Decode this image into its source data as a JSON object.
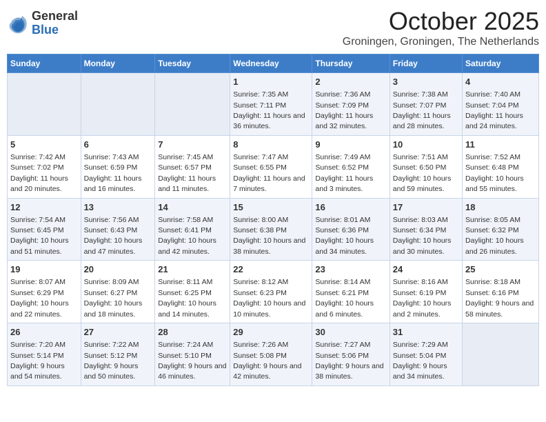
{
  "logo": {
    "general": "General",
    "blue": "Blue"
  },
  "title": "October 2025",
  "location": "Groningen, Groningen, The Netherlands",
  "days_of_week": [
    "Sunday",
    "Monday",
    "Tuesday",
    "Wednesday",
    "Thursday",
    "Friday",
    "Saturday"
  ],
  "weeks": [
    [
      {
        "day": "",
        "sunrise": "",
        "sunset": "",
        "daylight": "",
        "empty": true
      },
      {
        "day": "",
        "sunrise": "",
        "sunset": "",
        "daylight": "",
        "empty": true
      },
      {
        "day": "",
        "sunrise": "",
        "sunset": "",
        "daylight": "",
        "empty": true
      },
      {
        "day": "1",
        "sunrise": "Sunrise: 7:35 AM",
        "sunset": "Sunset: 7:11 PM",
        "daylight": "Daylight: 11 hours and 36 minutes."
      },
      {
        "day": "2",
        "sunrise": "Sunrise: 7:36 AM",
        "sunset": "Sunset: 7:09 PM",
        "daylight": "Daylight: 11 hours and 32 minutes."
      },
      {
        "day": "3",
        "sunrise": "Sunrise: 7:38 AM",
        "sunset": "Sunset: 7:07 PM",
        "daylight": "Daylight: 11 hours and 28 minutes."
      },
      {
        "day": "4",
        "sunrise": "Sunrise: 7:40 AM",
        "sunset": "Sunset: 7:04 PM",
        "daylight": "Daylight: 11 hours and 24 minutes."
      }
    ],
    [
      {
        "day": "5",
        "sunrise": "Sunrise: 7:42 AM",
        "sunset": "Sunset: 7:02 PM",
        "daylight": "Daylight: 11 hours and 20 minutes."
      },
      {
        "day": "6",
        "sunrise": "Sunrise: 7:43 AM",
        "sunset": "Sunset: 6:59 PM",
        "daylight": "Daylight: 11 hours and 16 minutes."
      },
      {
        "day": "7",
        "sunrise": "Sunrise: 7:45 AM",
        "sunset": "Sunset: 6:57 PM",
        "daylight": "Daylight: 11 hours and 11 minutes."
      },
      {
        "day": "8",
        "sunrise": "Sunrise: 7:47 AM",
        "sunset": "Sunset: 6:55 PM",
        "daylight": "Daylight: 11 hours and 7 minutes."
      },
      {
        "day": "9",
        "sunrise": "Sunrise: 7:49 AM",
        "sunset": "Sunset: 6:52 PM",
        "daylight": "Daylight: 11 hours and 3 minutes."
      },
      {
        "day": "10",
        "sunrise": "Sunrise: 7:51 AM",
        "sunset": "Sunset: 6:50 PM",
        "daylight": "Daylight: 10 hours and 59 minutes."
      },
      {
        "day": "11",
        "sunrise": "Sunrise: 7:52 AM",
        "sunset": "Sunset: 6:48 PM",
        "daylight": "Daylight: 10 hours and 55 minutes."
      }
    ],
    [
      {
        "day": "12",
        "sunrise": "Sunrise: 7:54 AM",
        "sunset": "Sunset: 6:45 PM",
        "daylight": "Daylight: 10 hours and 51 minutes."
      },
      {
        "day": "13",
        "sunrise": "Sunrise: 7:56 AM",
        "sunset": "Sunset: 6:43 PM",
        "daylight": "Daylight: 10 hours and 47 minutes."
      },
      {
        "day": "14",
        "sunrise": "Sunrise: 7:58 AM",
        "sunset": "Sunset: 6:41 PM",
        "daylight": "Daylight: 10 hours and 42 minutes."
      },
      {
        "day": "15",
        "sunrise": "Sunrise: 8:00 AM",
        "sunset": "Sunset: 6:38 PM",
        "daylight": "Daylight: 10 hours and 38 minutes."
      },
      {
        "day": "16",
        "sunrise": "Sunrise: 8:01 AM",
        "sunset": "Sunset: 6:36 PM",
        "daylight": "Daylight: 10 hours and 34 minutes."
      },
      {
        "day": "17",
        "sunrise": "Sunrise: 8:03 AM",
        "sunset": "Sunset: 6:34 PM",
        "daylight": "Daylight: 10 hours and 30 minutes."
      },
      {
        "day": "18",
        "sunrise": "Sunrise: 8:05 AM",
        "sunset": "Sunset: 6:32 PM",
        "daylight": "Daylight: 10 hours and 26 minutes."
      }
    ],
    [
      {
        "day": "19",
        "sunrise": "Sunrise: 8:07 AM",
        "sunset": "Sunset: 6:29 PM",
        "daylight": "Daylight: 10 hours and 22 minutes."
      },
      {
        "day": "20",
        "sunrise": "Sunrise: 8:09 AM",
        "sunset": "Sunset: 6:27 PM",
        "daylight": "Daylight: 10 hours and 18 minutes."
      },
      {
        "day": "21",
        "sunrise": "Sunrise: 8:11 AM",
        "sunset": "Sunset: 6:25 PM",
        "daylight": "Daylight: 10 hours and 14 minutes."
      },
      {
        "day": "22",
        "sunrise": "Sunrise: 8:12 AM",
        "sunset": "Sunset: 6:23 PM",
        "daylight": "Daylight: 10 hours and 10 minutes."
      },
      {
        "day": "23",
        "sunrise": "Sunrise: 8:14 AM",
        "sunset": "Sunset: 6:21 PM",
        "daylight": "Daylight: 10 hours and 6 minutes."
      },
      {
        "day": "24",
        "sunrise": "Sunrise: 8:16 AM",
        "sunset": "Sunset: 6:19 PM",
        "daylight": "Daylight: 10 hours and 2 minutes."
      },
      {
        "day": "25",
        "sunrise": "Sunrise: 8:18 AM",
        "sunset": "Sunset: 6:16 PM",
        "daylight": "Daylight: 9 hours and 58 minutes."
      }
    ],
    [
      {
        "day": "26",
        "sunrise": "Sunrise: 7:20 AM",
        "sunset": "Sunset: 5:14 PM",
        "daylight": "Daylight: 9 hours and 54 minutes."
      },
      {
        "day": "27",
        "sunrise": "Sunrise: 7:22 AM",
        "sunset": "Sunset: 5:12 PM",
        "daylight": "Daylight: 9 hours and 50 minutes."
      },
      {
        "day": "28",
        "sunrise": "Sunrise: 7:24 AM",
        "sunset": "Sunset: 5:10 PM",
        "daylight": "Daylight: 9 hours and 46 minutes."
      },
      {
        "day": "29",
        "sunrise": "Sunrise: 7:26 AM",
        "sunset": "Sunset: 5:08 PM",
        "daylight": "Daylight: 9 hours and 42 minutes."
      },
      {
        "day": "30",
        "sunrise": "Sunrise: 7:27 AM",
        "sunset": "Sunset: 5:06 PM",
        "daylight": "Daylight: 9 hours and 38 minutes."
      },
      {
        "day": "31",
        "sunrise": "Sunrise: 7:29 AM",
        "sunset": "Sunset: 5:04 PM",
        "daylight": "Daylight: 9 hours and 34 minutes."
      },
      {
        "day": "",
        "sunrise": "",
        "sunset": "",
        "daylight": "",
        "empty": true
      }
    ]
  ]
}
